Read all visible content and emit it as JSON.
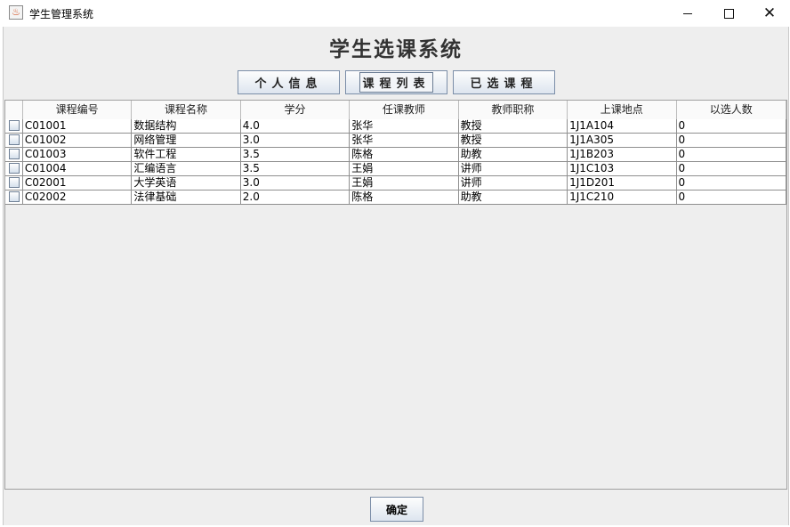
{
  "window": {
    "title": "学生管理系统",
    "app_icon": "java-cup-icon",
    "app_icon_glyph": "♨",
    "min_label": "",
    "close_glyph": "✕"
  },
  "heading": "学生选课系统",
  "tabs": [
    {
      "label": "个人信息",
      "active": false
    },
    {
      "label": "课程列表",
      "active": true
    },
    {
      "label": "已选课程",
      "active": false
    }
  ],
  "table": {
    "columns": [
      "",
      "课程编号",
      "课程名称",
      "学分",
      "任课教师",
      "教师职称",
      "上课地点",
      "以选人数"
    ],
    "rows": [
      {
        "code": "C01001",
        "name": "数据结构",
        "credit": "4.0",
        "teacher": "张华",
        "title": "教授",
        "room": "1J1A104",
        "count": "0"
      },
      {
        "code": "C01002",
        "name": "网络管理",
        "credit": "3.0",
        "teacher": "张华",
        "title": "教授",
        "room": "1J1A305",
        "count": "0"
      },
      {
        "code": "C01003",
        "name": "软件工程",
        "credit": "3.5",
        "teacher": "陈格",
        "title": "助教",
        "room": "1J1B203",
        "count": "0"
      },
      {
        "code": "C01004",
        "name": "汇编语言",
        "credit": "3.5",
        "teacher": "王娟",
        "title": "讲师",
        "room": "1J1C103",
        "count": "0"
      },
      {
        "code": "C02001",
        "name": "大学英语",
        "credit": "3.0",
        "teacher": "王娟",
        "title": "讲师",
        "room": "1J1D201",
        "count": "0"
      },
      {
        "code": "C02002",
        "name": "法律基础",
        "credit": "2.0",
        "teacher": "陈格",
        "title": "助教",
        "room": "1J1C210",
        "count": "0"
      }
    ]
  },
  "ok_button": "确定"
}
